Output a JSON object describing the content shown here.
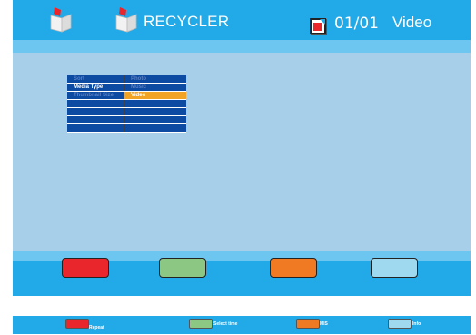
{
  "header": {
    "title": "RECYCLER",
    "page": "01/01",
    "media": "Video",
    "icons": [
      "folder-icon",
      "recycler-folder-icon",
      "page-icon"
    ]
  },
  "menu": {
    "rows": [
      {
        "label": "Sort",
        "value": "Photo"
      },
      {
        "label": "Media Type",
        "value": "Music"
      },
      {
        "label": "Thumbnail Size",
        "value": "Video"
      },
      {
        "label": "",
        "value": ""
      },
      {
        "label": "",
        "value": ""
      },
      {
        "label": "",
        "value": ""
      },
      {
        "label": "",
        "value": ""
      }
    ]
  },
  "buttons": {
    "colors": {
      "red": "#e8262c",
      "green": "#8cc784",
      "orange": "#f07a24",
      "cyan": "#9ed9ef"
    }
  },
  "legend": {
    "red": "Repeat",
    "green": "Select time",
    "orange": "MIS",
    "cyan": "Info"
  }
}
